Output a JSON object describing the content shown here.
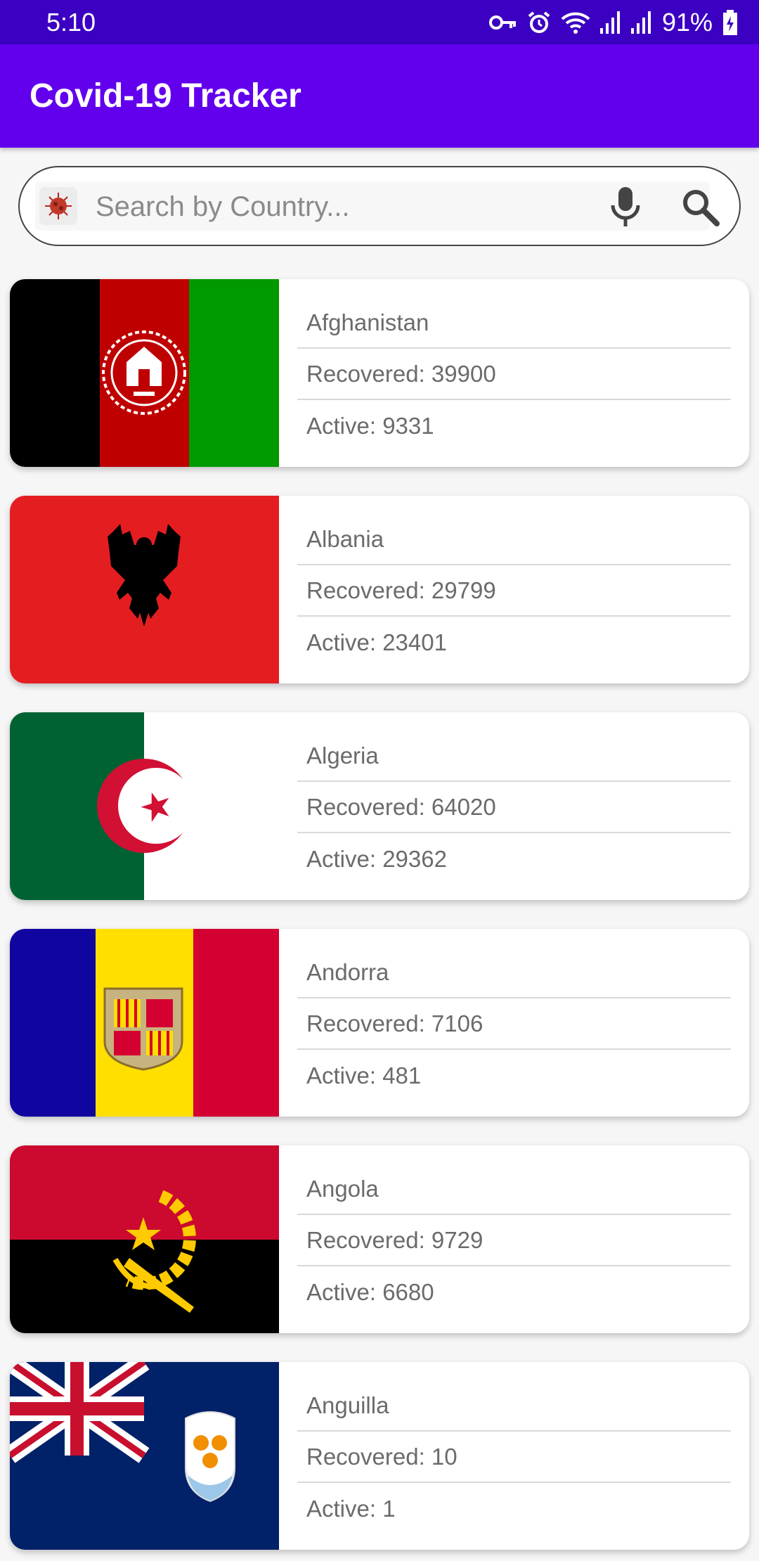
{
  "status_bar": {
    "time": "5:10",
    "battery": "91%",
    "icons": [
      "vpn-key-icon",
      "alarm-icon",
      "wifi-icon",
      "signal-icon",
      "signal-icon",
      "battery-charging-icon"
    ]
  },
  "app_bar": {
    "title": "Covid-19 Tracker",
    "color": "#6200ee"
  },
  "search": {
    "placeholder": "Search by Country...",
    "value": "",
    "icons": [
      "virus-icon",
      "mic-icon",
      "search-icon"
    ]
  },
  "countries": [
    {
      "name": "Afghanistan",
      "recovered": "Recovered: 39900",
      "active": "Active: 9331",
      "flag": "afghanistan-flag"
    },
    {
      "name": "Albania",
      "recovered": "Recovered: 29799",
      "active": "Active: 23401",
      "flag": "albania-flag"
    },
    {
      "name": "Algeria",
      "recovered": "Recovered: 64020",
      "active": "Active: 29362",
      "flag": "algeria-flag"
    },
    {
      "name": "Andorra",
      "recovered": "Recovered: 7106",
      "active": "Active: 481",
      "flag": "andorra-flag"
    },
    {
      "name": "Angola",
      "recovered": "Recovered: 9729",
      "active": "Active: 6680",
      "flag": "angola-flag"
    },
    {
      "name": "Anguilla",
      "recovered": "Recovered: 10",
      "active": "Active: 1",
      "flag": "anguilla-flag"
    }
  ]
}
